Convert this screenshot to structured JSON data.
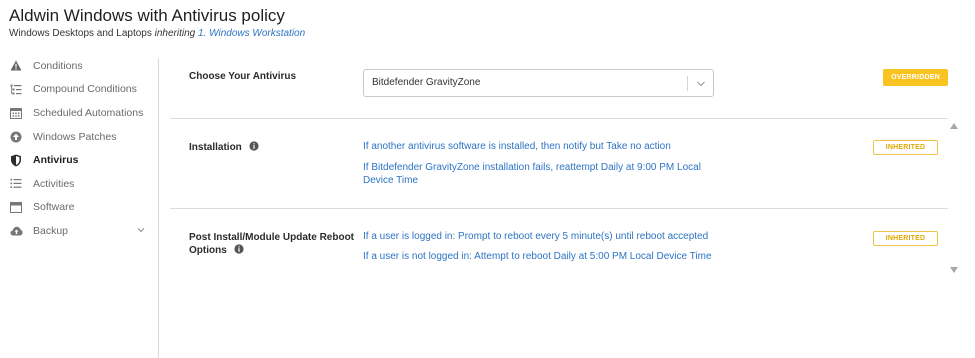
{
  "header": {
    "title": "Aldwin Windows with Antivirus policy",
    "subtitle_prefix": "Windows Desktops and Laptops",
    "subtitle_inheriting": "inheriting",
    "subtitle_link": "1. Windows Workstation"
  },
  "sidebar": {
    "items": [
      {
        "label": "Conditions",
        "icon": "warning-icon"
      },
      {
        "label": "Compound Conditions",
        "icon": "list-tree-icon"
      },
      {
        "label": "Scheduled Automations",
        "icon": "calendar-icon"
      },
      {
        "label": "Windows Patches",
        "icon": "arrow-up-circle-icon"
      },
      {
        "label": "Antivirus",
        "icon": "shield-icon",
        "active": true
      },
      {
        "label": "Activities",
        "icon": "list-icon"
      },
      {
        "label": "Software",
        "icon": "window-icon"
      },
      {
        "label": "Backup",
        "icon": "cloud-upload-icon",
        "expandable": true
      }
    ]
  },
  "antivirus": {
    "label": "Choose Your Antivirus",
    "selected": "Bitdefender GravityZone",
    "badge": "OVERRIDDEN"
  },
  "installation": {
    "label": "Installation",
    "line1": "If another antivirus software is installed, then notify but Take no action",
    "line2a": "If Bitdefender GravityZone installation fails, reattempt Daily at 9:00 PM Local",
    "line2b": "Device Time",
    "badge": "INHERITED"
  },
  "reboot": {
    "label_line1": "Post Install/Module Update Reboot",
    "label_line2": "Options",
    "line1": "If a user is logged in: Prompt to reboot every 5 minute(s) until reboot accepted",
    "line2": "If a user is not logged in: Attempt to reboot Daily at 5:00 PM Local Device Time",
    "badge": "INHERITED"
  },
  "colors": {
    "link": "#2d74c4",
    "overridden": "#f9c322",
    "inherited_border": "#f0c24a"
  }
}
